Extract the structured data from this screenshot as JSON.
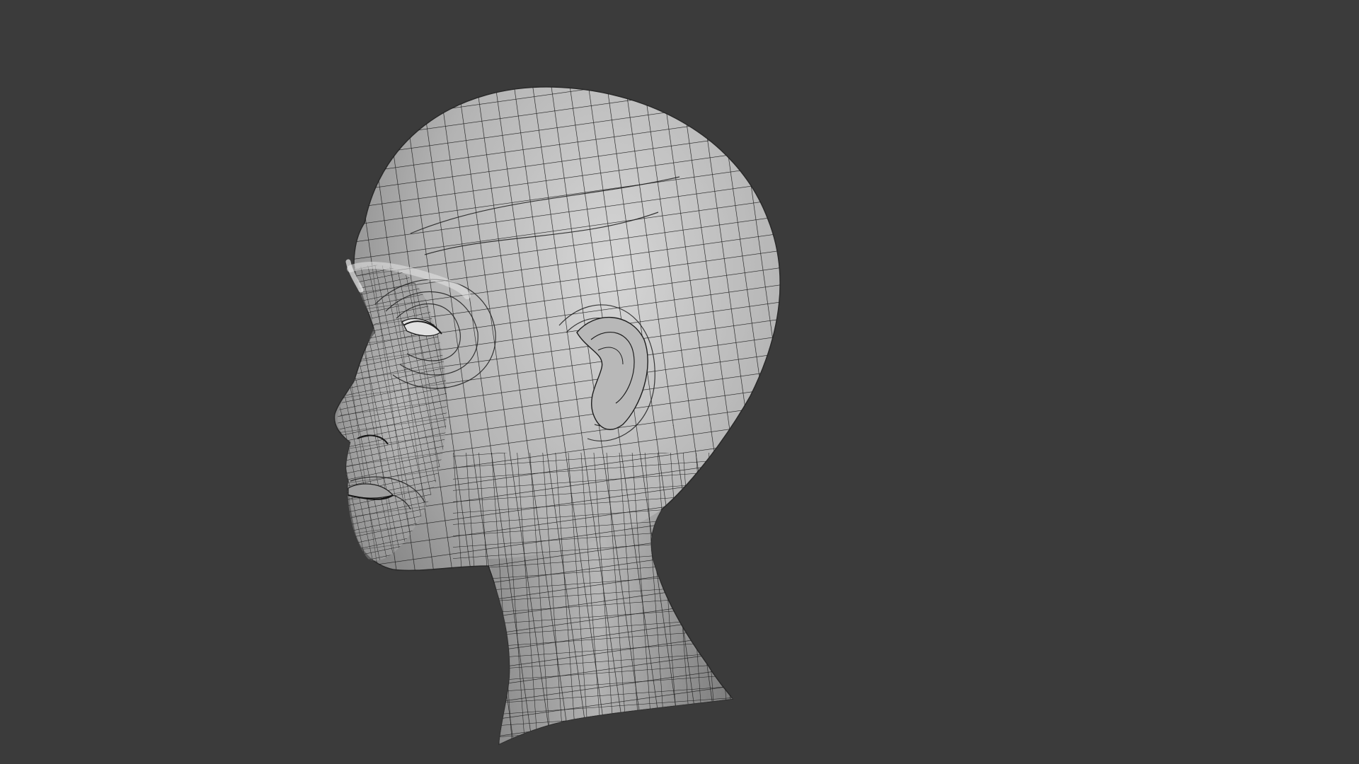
{
  "viewport": {
    "background_color": "#3b3b3b",
    "object": {
      "name_icon": "head-mesh",
      "display_mode": "wireframe-on-shaded",
      "surface_color": "#a9a9a9",
      "highlight_color": "#d8d8d8",
      "shadow_color": "#6e6e6e",
      "wire_color": "#1a1a1a"
    }
  }
}
